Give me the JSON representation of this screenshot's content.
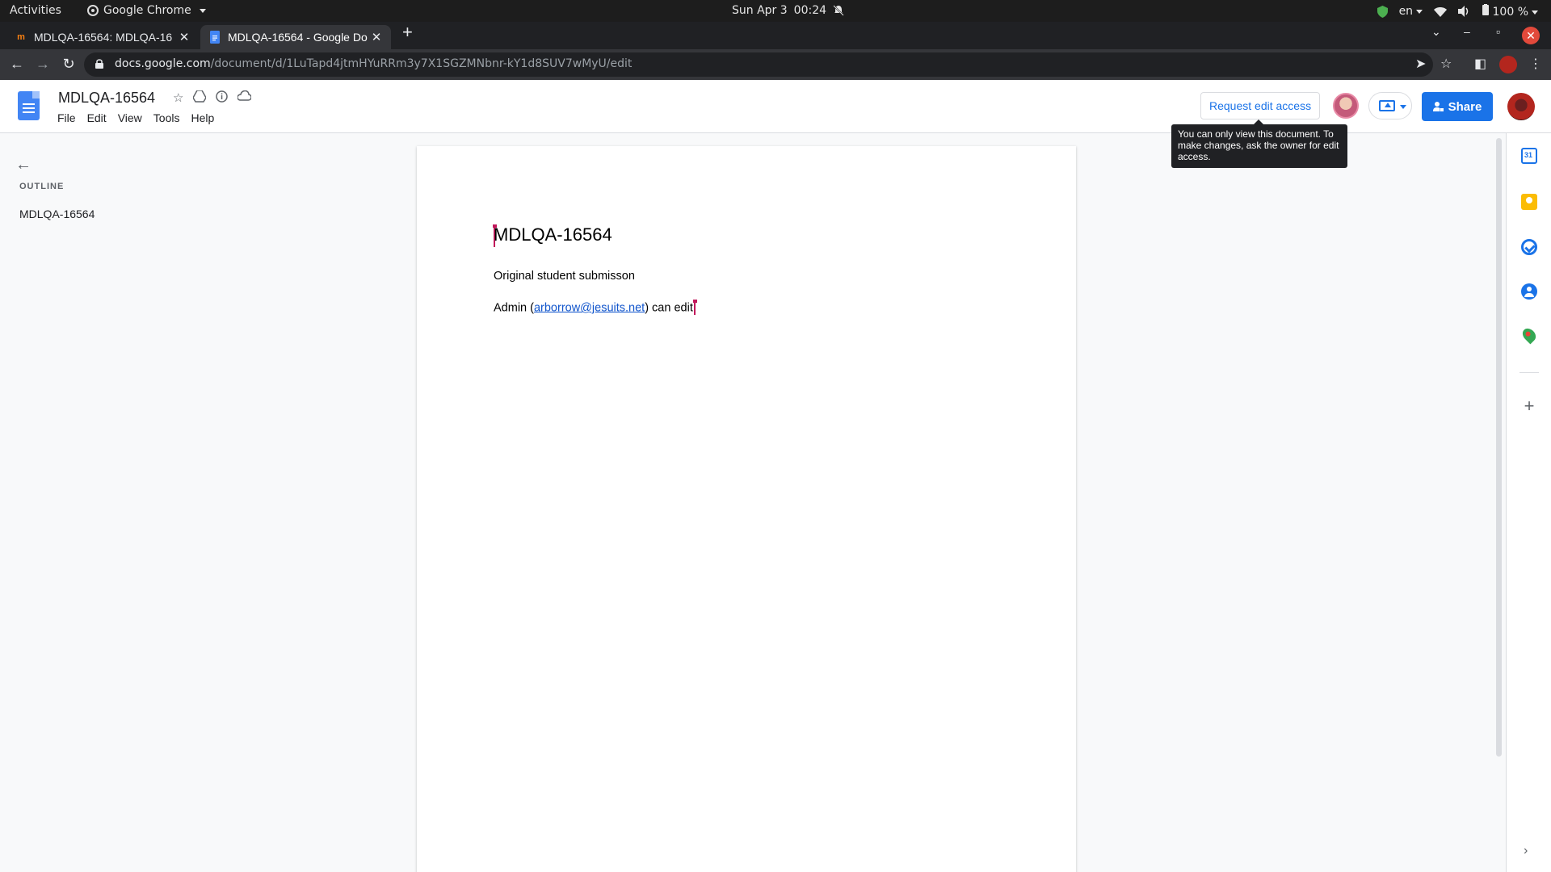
{
  "system_bar": {
    "activities": "Activities",
    "app_name": "Google Chrome",
    "date": "Sun Apr 3",
    "time": "00:24",
    "language": "en",
    "battery": "100 %"
  },
  "browser": {
    "tabs": [
      {
        "favicon": "moodle-icon",
        "title": "MDLQA-16564: MDLQA-16",
        "active": false
      },
      {
        "favicon": "docs-icon",
        "title": "MDLQA-16564 - Google Do",
        "active": true
      }
    ],
    "url_host": "docs.google.com",
    "url_path": "/document/d/1LuTapd4jtmHYuRRm3y7X1SGZMNbnr-kY1d8SUV7wMyU/edit"
  },
  "docs": {
    "title": "MDLQA-16564",
    "menu": [
      "File",
      "Edit",
      "View",
      "Tools",
      "Help"
    ],
    "request_edit_label": "Request edit access",
    "share_label": "Share",
    "tooltip": "You can only view this document. To make changes, ask the owner for edit access."
  },
  "outline": {
    "label": "OUTLINE",
    "items": [
      "MDLQA-16564"
    ]
  },
  "document": {
    "heading": "MDLQA-16564",
    "paragraph1": "Original student submisson",
    "p2_prefix": "Admin (",
    "p2_link": "arborrow@jesuits.net",
    "p2_suffix": ") can edit"
  },
  "colors": {
    "accent": "#1a73e8",
    "cursor": "#c2185b",
    "link": "#1155cc"
  }
}
